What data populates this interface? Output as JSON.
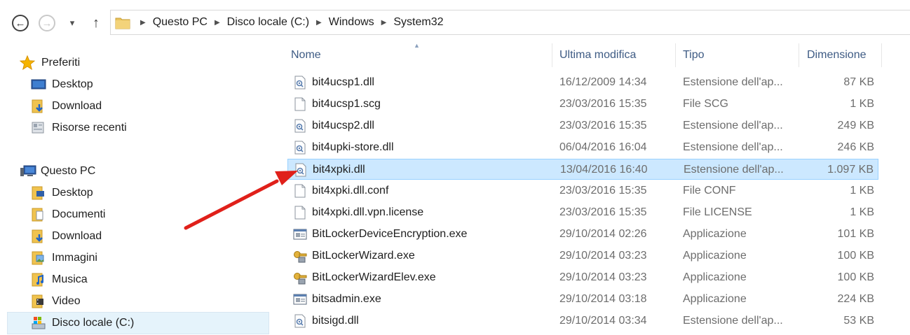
{
  "address": {
    "back_glyph": "←",
    "forward_glyph": "→",
    "recent_glyph": "▾",
    "up_glyph": "↑",
    "crumbs": [
      "Questo PC",
      "Disco locale (C:)",
      "Windows",
      "System32"
    ]
  },
  "nav": {
    "favorites_label": "Preferiti",
    "favorites": [
      "Desktop",
      "Download",
      "Risorse recenti"
    ],
    "thispc_label": "Questo PC",
    "thispc": [
      "Desktop",
      "Documenti",
      "Download",
      "Immagini",
      "Musica",
      "Video",
      "Disco locale (C:)"
    ]
  },
  "columns": {
    "name": "Nome",
    "modified": "Ultima modifica",
    "type": "Tipo",
    "size": "Dimensione"
  },
  "files": [
    {
      "name": "bit4ucsp1.dll",
      "modified": "16/12/2009 14:34",
      "type": "Estensione dell'ap...",
      "size": "87 KB",
      "icon": "dll-icon"
    },
    {
      "name": "bit4ucsp1.scg",
      "modified": "23/03/2016 15:35",
      "type": "File SCG",
      "size": "1 KB",
      "icon": "file-icon"
    },
    {
      "name": "bit4ucsp2.dll",
      "modified": "23/03/2016 15:35",
      "type": "Estensione dell'ap...",
      "size": "249 KB",
      "icon": "dll-icon"
    },
    {
      "name": "bit4upki-store.dll",
      "modified": "06/04/2016 16:04",
      "type": "Estensione dell'ap...",
      "size": "246 KB",
      "icon": "dll-icon"
    },
    {
      "name": "bit4xpki.dll",
      "modified": "13/04/2016 16:40",
      "type": "Estensione dell'ap...",
      "size": "1.097 KB",
      "icon": "dll-icon",
      "selected": true
    },
    {
      "name": "bit4xpki.dll.conf",
      "modified": "23/03/2016 15:35",
      "type": "File CONF",
      "size": "1 KB",
      "icon": "file-icon"
    },
    {
      "name": "bit4xpki.dll.vpn.license",
      "modified": "23/03/2016 15:35",
      "type": "File LICENSE",
      "size": "1 KB",
      "icon": "file-icon"
    },
    {
      "name": "BitLockerDeviceEncryption.exe",
      "modified": "29/10/2014 02:26",
      "type": "Applicazione",
      "size": "101 KB",
      "icon": "exe-icon"
    },
    {
      "name": "BitLockerWizard.exe",
      "modified": "29/10/2014 03:23",
      "type": "Applicazione",
      "size": "100 KB",
      "icon": "bitlocker-key-icon"
    },
    {
      "name": "BitLockerWizardElev.exe",
      "modified": "29/10/2014 03:23",
      "type": "Applicazione",
      "size": "100 KB",
      "icon": "bitlocker-key-icon"
    },
    {
      "name": "bitsadmin.exe",
      "modified": "29/10/2014 03:18",
      "type": "Applicazione",
      "size": "224 KB",
      "icon": "exe-icon"
    },
    {
      "name": "bitsigd.dll",
      "modified": "29/10/2014 03:34",
      "type": "Estensione dell'ap...",
      "size": "53 KB",
      "icon": "dll-icon"
    }
  ],
  "colors": {
    "selection_bg": "#cce8ff",
    "selection_border": "#99d1ff",
    "header_text": "#3e5b84",
    "annotation_arrow": "#e0201a"
  }
}
